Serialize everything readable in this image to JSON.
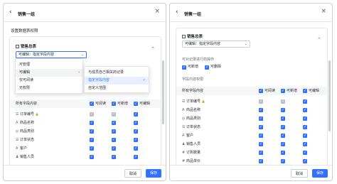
{
  "left": {
    "header": {
      "title": "销售一组"
    },
    "section_title": "设置数据表权限",
    "card": {
      "title": "销售总表",
      "select": {
        "prefix": "可编辑：",
        "value": "指定字段内容"
      },
      "table": {
        "headers": [
          "所有字段内容",
          "可阅读",
          "可新增",
          "可编辑"
        ],
        "rows": [
          {
            "icon": "☰",
            "name": "订单编号",
            "lock": "🔒"
          },
          {
            "icon": "A",
            "name": "商品名称"
          },
          {
            "icon": "◎",
            "name": "商品类别"
          },
          {
            "icon": "☰",
            "name": "订单状态"
          },
          {
            "icon": "A",
            "name": "客户"
          },
          {
            "icon": "♟",
            "name": "销售人员"
          }
        ]
      }
    },
    "dropdown_primary": {
      "items": [
        "可管理",
        "可编辑",
        "仅可阅读",
        "无权限"
      ],
      "active_index": 1,
      "arrow": "›"
    },
    "dropdown_secondary": {
      "items": [
        "与成员自己相关的记录",
        "指定字段内容",
        "自定义范围"
      ],
      "selected_index": 1,
      "tick": "✓"
    },
    "footer": {
      "cancel": "取消",
      "save": "保存"
    }
  },
  "right": {
    "header": {
      "title": "销售一组"
    },
    "card": {
      "title": "销售总表",
      "select": {
        "prefix": "可编辑：",
        "value": "指定字段内容"
      },
      "ops_label": "可对记录进行的操作",
      "ops": [
        "可新增",
        "可删除"
      ],
      "fields_label": "字段内容权限",
      "table": {
        "headers": [
          "所有字段内容",
          "可阅读",
          "可新增",
          "可编辑"
        ],
        "rows": [
          {
            "icon": "☰",
            "name": "订单编号",
            "lock": "🔒"
          },
          {
            "icon": "A",
            "name": "商品名称"
          },
          {
            "icon": "◎",
            "name": "商品类别"
          },
          {
            "icon": "☰",
            "name": "订单状态"
          },
          {
            "icon": "A",
            "name": "客户"
          },
          {
            "icon": "♟",
            "name": "销售人员"
          },
          {
            "icon": "#",
            "name": "订购数量"
          },
          {
            "icon": "#",
            "name": "商品单价"
          }
        ]
      }
    },
    "footer": {
      "cancel": "取消",
      "save": "保存"
    }
  },
  "colors": {
    "accent": "#3370ff",
    "disabled": "#bbbfc4",
    "border": "#c9cdd4"
  }
}
